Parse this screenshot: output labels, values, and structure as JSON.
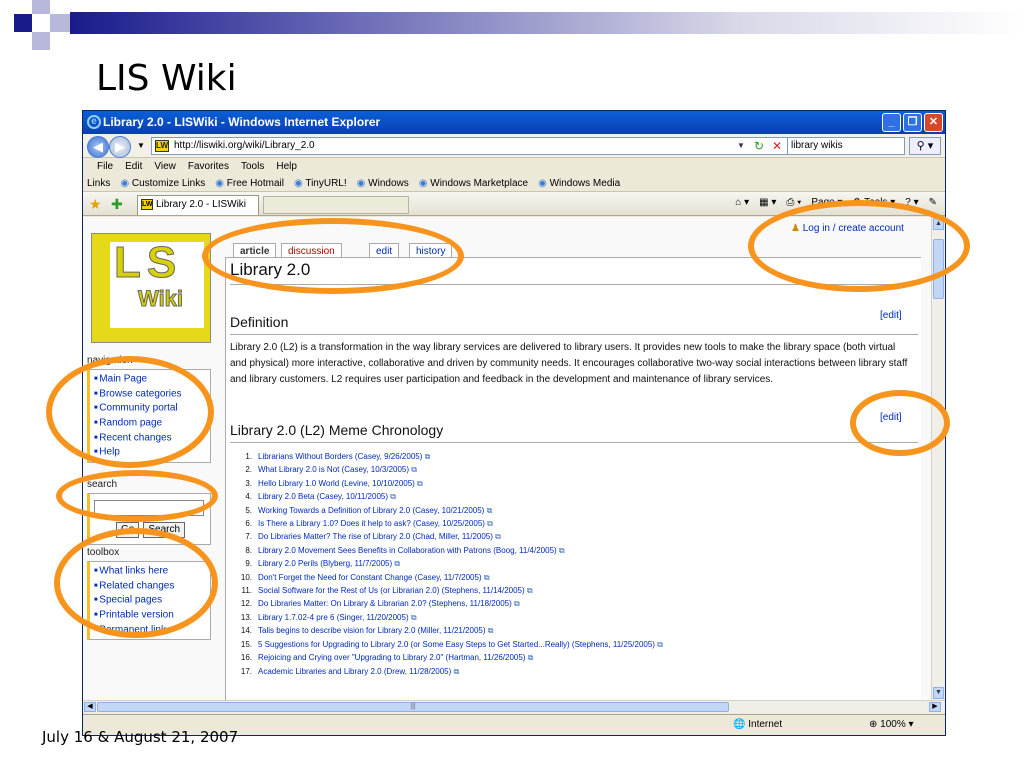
{
  "slide": {
    "title": "LIS Wiki",
    "footer_date": "July 16 & August 21, 2007"
  },
  "window": {
    "title": "Library 2.0 - LISWiki - Windows Internet Explorer",
    "url": "http://liswiki.org/wiki/Library_2.0",
    "search_value": "library wikis",
    "menu": [
      "File",
      "Edit",
      "View",
      "Favorites",
      "Tools",
      "Help"
    ],
    "links_label": "Links",
    "links": [
      "Customize Links",
      "Free Hotmail",
      "TinyURL!",
      "Windows",
      "Windows Marketplace",
      "Windows Media"
    ],
    "tab_title": "Library 2.0 - LISWiki",
    "page_menu": "Page",
    "tools_menu": "Tools",
    "status_zone": "Internet",
    "zoom": "100%"
  },
  "wiki": {
    "logo_top": "LS",
    "logo_bottom": "Wiki",
    "tabs": [
      "article",
      "discussion",
      "edit",
      "history"
    ],
    "login": "Log in / create account",
    "page_title": "Library 2.0",
    "section1": "Definition",
    "edit_label": "[edit]",
    "definition": "Library 2.0 (L2) is a transformation in the way library services are delivered to library users. It provides new tools to make the library space (both virtual and physical) more interactive, collaborative and driven by community needs. It encourages collaborative two-way social interactions between library staff and library customers. L2 requires user participation and feedback in the development and maintenance of library services.",
    "section2": "Library 2.0 (L2) Meme Chronology",
    "navigation_title": "navigation",
    "navigation": [
      "Main Page",
      "Browse categories",
      "Community portal",
      "Random page",
      "Recent changes",
      "Help"
    ],
    "search_title": "search",
    "go_button": "Go",
    "search_button": "Search",
    "toolbox_title": "toolbox",
    "toolbox": [
      "What links here",
      "Related changes",
      "Special pages",
      "Printable version",
      "Permanent link"
    ],
    "chronology": [
      "Librarians Without Borders (Casey, 9/26/2005)",
      "What Library 2.0 is Not (Casey, 10/3/2005)",
      "Hello Library 1.0 World (Levine, 10/10/2005)",
      "Library 2.0 Beta (Casey, 10/11/2005)",
      "Working Towards a Definition of Library 2.0 (Casey, 10/21/2005)",
      "Is There a Library 1.0? Does it help to ask? (Casey, 10/25/2005)",
      "Do Libraries Matter? The rise of Library 2.0 (Chad, Miller, 11/2005)",
      "Library 2.0 Movement Sees Benefits in Collaboration with Patrons (Boog, 11/4/2005)",
      "Library 2.0 Perils (Blyberg, 11/7/2005)",
      "Don't Forget the Need for Constant Change (Casey, 11/7/2005)",
      "Social Software for the Rest of Us (or Librarian 2.0) (Stephens, 11/14/2005)",
      "Do Libraries Matter: On Library & Librarian 2.0? (Stephens, 11/18/2005)",
      "Library 1.7.02-4 pre 6 (Singer, 11/20/2005)",
      "Talis begins to describe vision for Library 2.0 (Miller, 11/21/2005)",
      "5 Suggestions for Upgrading to Library 2.0 (or Some Easy Steps to Get Started...Really) (Stephens, 11/25/2005)",
      "Rejoicing and Crying over \"Upgrading to Library 2.0\" (Hartman, 11/26/2005)",
      "Academic Libraries and Library 2.0 (Drew, 11/28/2005)"
    ]
  },
  "colors": {
    "annotation": "#f7941d",
    "link": "#002bb8",
    "title_band": "#1a1a8c"
  }
}
